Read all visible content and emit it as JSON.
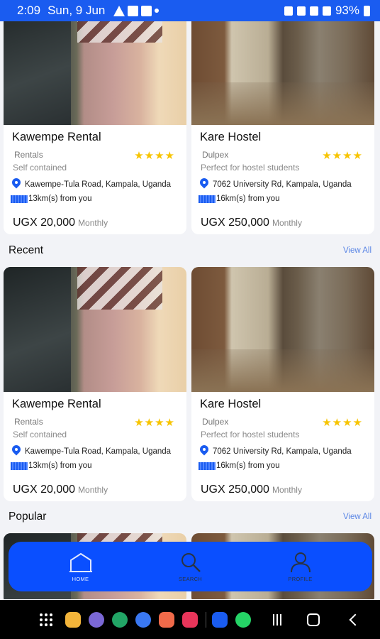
{
  "status_bar": {
    "time": "2:09",
    "date": "Sun, 9 Jun",
    "battery": "93%"
  },
  "listings_top": [
    {
      "title": "Kawempe Rental",
      "type": "Rentals",
      "description": "Self contained",
      "stars": "★★★★",
      "location": "Kawempe-Tula Road, Kampala, Uganda",
      "distance": "13km(s) from you",
      "price": "UGX 20,000",
      "period": "Monthly"
    },
    {
      "title": "Kare Hostel",
      "type": "Dulpex",
      "description": "Perfect for hostel students",
      "stars": "★★★★",
      "location": "7062 University Rd, Kampala, Uganda",
      "distance": "16km(s) from you",
      "price": "UGX 250,000",
      "period": "Monthly"
    }
  ],
  "sections": {
    "recent": {
      "title": "Recent",
      "view_all": "View All"
    },
    "popular": {
      "title": "Popular",
      "view_all": "View All"
    }
  },
  "listings_recent": [
    {
      "title": "Kawempe Rental",
      "type": "Rentals",
      "description": "Self contained",
      "stars": "★★★★",
      "location": "Kawempe-Tula Road, Kampala, Uganda",
      "distance": "13km(s) from you",
      "price": "UGX 20,000",
      "period": "Monthly"
    },
    {
      "title": "Kare Hostel",
      "type": "Dulpex",
      "description": "Perfect for hostel students",
      "stars": "★★★★",
      "location": "7062 University Rd, Kampala, Uganda",
      "distance": "16km(s) from you",
      "price": "UGX 250,000",
      "period": "Monthly"
    }
  ],
  "bottom_nav": {
    "home": "HOME",
    "search": "SEARCH",
    "profile": "PROFILE"
  },
  "colors": {
    "primary": "#0a4fff",
    "star": "#f7c400",
    "link": "#5b86e5"
  }
}
